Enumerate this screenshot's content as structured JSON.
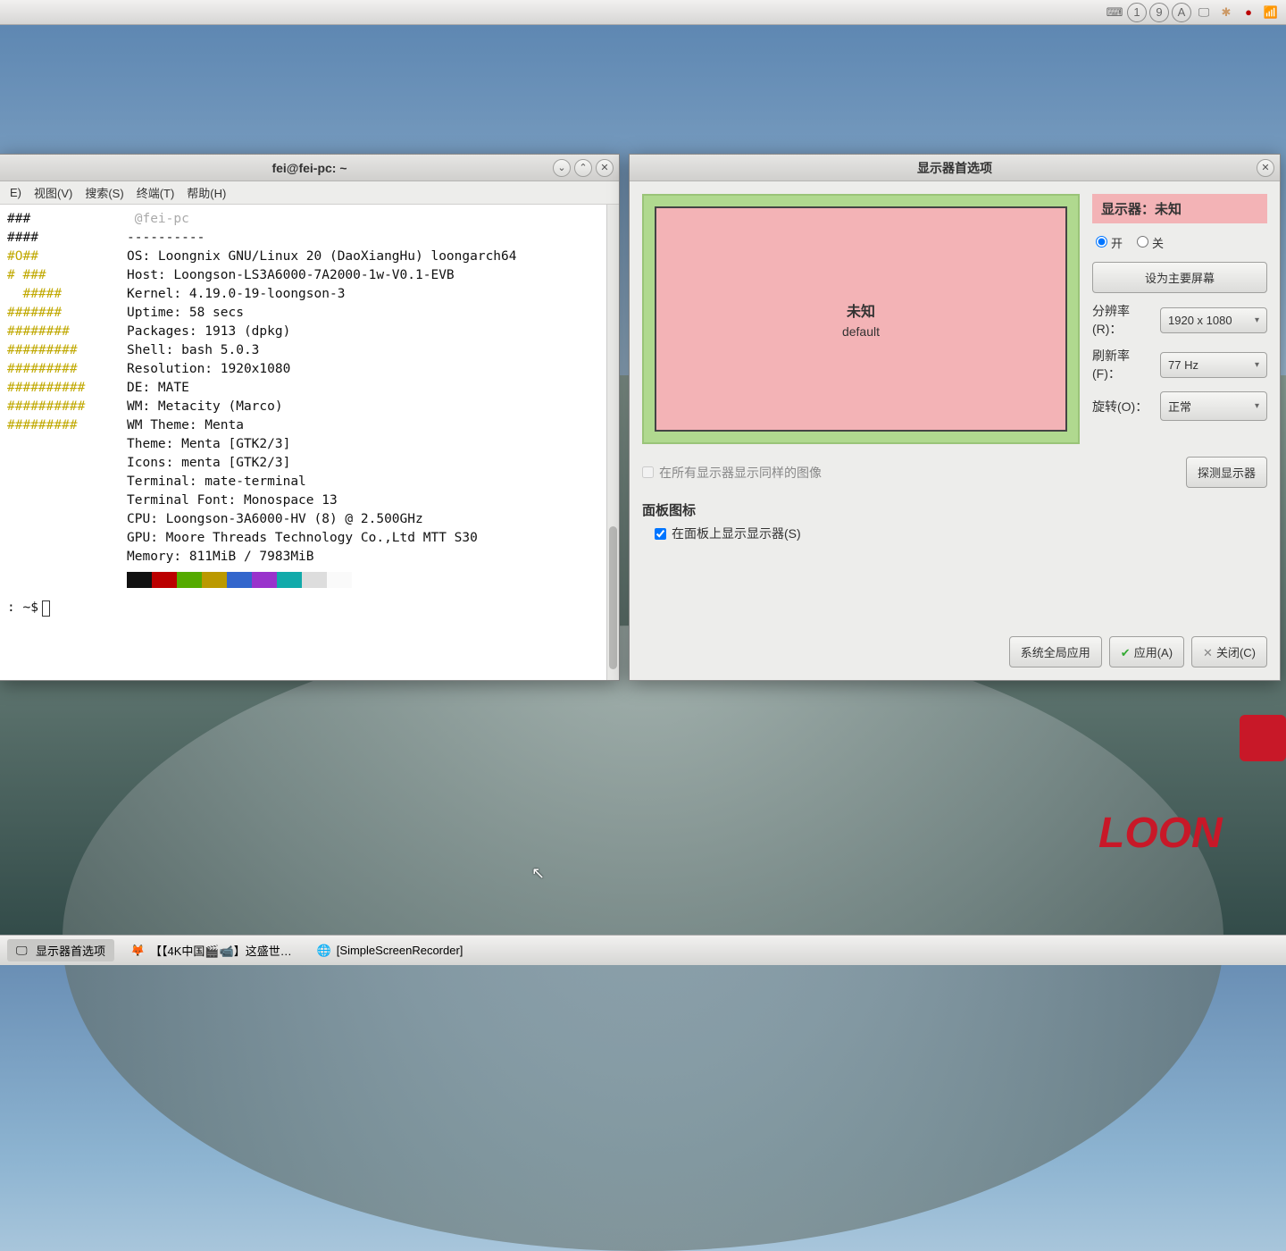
{
  "top_panel": {
    "tray": [
      "kbd",
      "1",
      "9",
      "A",
      "screen",
      "gear",
      "rec",
      "net"
    ]
  },
  "terminal": {
    "title": "fei@fei-pc: ~",
    "menu": {
      "e": "E)",
      "view": "视图(V)",
      "search": "搜索(S)",
      "terminal": "终端(T)",
      "help": "帮助(H)"
    },
    "user_host": " @fei-pc",
    "sep": "----------",
    "info": {
      "os": "OS: Loongnix GNU/Linux 20 (DaoXiangHu) loongarch64",
      "host": "Host: Loongson-LS3A6000-7A2000-1w-V0.1-EVB",
      "kernel": "Kernel: 4.19.0-19-loongson-3",
      "uptime": "Uptime: 58 secs",
      "packages": "Packages: 1913 (dpkg)",
      "shell": "Shell: bash 5.0.3",
      "res": "Resolution: 1920x1080",
      "de": "DE: MATE",
      "wm": "WM: Metacity (Marco)",
      "wmtheme": "WM Theme: Menta",
      "theme": "Theme: Menta [GTK2/3]",
      "icons": "Icons: menta [GTK2/3]",
      "term": "Terminal: mate-terminal",
      "termfont": "Terminal Font: Monospace 13",
      "cpu": "CPU: Loongson-3A6000-HV (8) @ 2.500GHz",
      "gpu": "GPU: Moore Threads Technology Co.,Ltd MTT S30",
      "mem": "Memory: 811MiB / 7983MiB"
    },
    "ascii": [
      "###",
      "####",
      "#O##",
      "# ###",
      "  #####",
      "#######",
      "########",
      "#########",
      "########",
      "#####",
      "###",
      "####"
    ],
    "ascii_yellow_tail": [
      "",
      "",
      "",
      "",
      "",
      "",
      "",
      "",
      "#",
      "#####",
      "#######",
      "#####"
    ],
    "swatches": [
      "#111",
      "#b00",
      "#5a0",
      "#b90",
      "#36c",
      "#93c",
      "#1aa",
      "#ddd",
      "#fafafa"
    ],
    "prompt": ": ~$ "
  },
  "display": {
    "title": "显示器首选项",
    "monitor": {
      "name": "未知",
      "sub": "default"
    },
    "side": {
      "label": "显示器：未知",
      "on": "开",
      "off": "关",
      "primary": "设为主要屏幕",
      "res_label": "分辨率(R)：",
      "res_value": "1920 x 1080",
      "refresh_label": "刷新率(F)：",
      "refresh_value": "77 Hz",
      "rotate_label": "旋转(O)：",
      "rotate_value": "正常"
    },
    "same_image": "在所有显示器显示同样的图像",
    "detect": "探测显示器",
    "panel_icon_header": "面板图标",
    "panel_icon_check": "在面板上显示显示器(S)",
    "footer": {
      "global": "系统全局应用",
      "apply": "应用(A)",
      "close": "关闭(C)"
    }
  },
  "taskbar": {
    "item1": "显示器首选项",
    "item2": "【【4K中国🎬📹】这盛世…",
    "item3": "[SimpleScreenRecorder]"
  },
  "logo": "LOON"
}
